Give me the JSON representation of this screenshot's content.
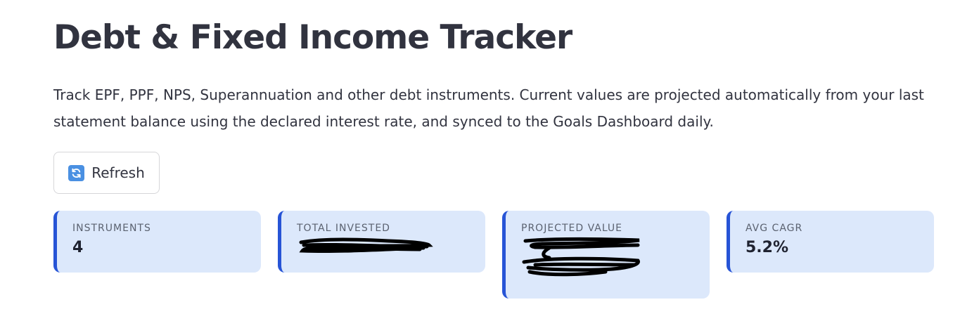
{
  "header": {
    "title": "Debt & Fixed Income Tracker",
    "description": "Track EPF, PPF, NPS, Superannuation and other debt instruments. Current values are projected automatically from your last statement balance using the declared interest rate, and synced to the Goals Dashboard daily."
  },
  "toolbar": {
    "refresh_label": "Refresh",
    "refresh_icon": "refresh-icon"
  },
  "metrics": [
    {
      "label": "INSTRUMENTS",
      "value": "4"
    },
    {
      "label": "TOTAL INVESTED",
      "value": ""
    },
    {
      "label": "PROJECTED VALUE",
      "value": ""
    },
    {
      "label": "AVG CAGR",
      "value": "5.2%"
    }
  ],
  "colors": {
    "card_bg": "#dce8fb",
    "card_accent": "#2754d6",
    "text": "#31333f"
  }
}
